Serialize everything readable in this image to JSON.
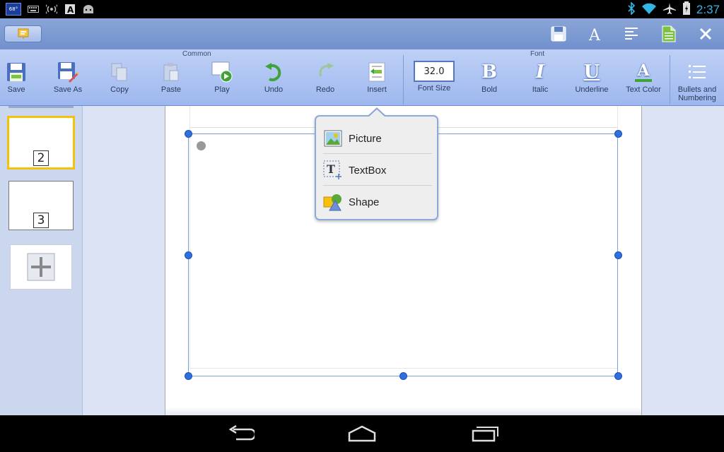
{
  "status_bar": {
    "temperature": "68°",
    "time": "2:37",
    "icons": [
      "keyboard-icon",
      "signal-icon",
      "font-app-icon",
      "android-icon",
      "bluetooth-icon",
      "wifi-icon",
      "airplane-icon",
      "battery-icon"
    ]
  },
  "title_bar": {
    "actions": [
      "save-icon",
      "font-icon",
      "align-icon",
      "document-icon",
      "close-icon"
    ]
  },
  "ribbon": {
    "common_title": "Common",
    "font_title": "Font",
    "save": "Save",
    "save_as": "Save As",
    "copy": "Copy",
    "paste": "Paste",
    "play": "Play",
    "undo": "Undo",
    "redo": "Redo",
    "insert": "Insert",
    "font_size_value": "32.0",
    "font_size": "Font Size",
    "bold": "Bold",
    "bold_glyph": "B",
    "italic": "Italic",
    "italic_glyph": "I",
    "underline": "Underline",
    "underline_glyph": "U",
    "text_color": "Text Color",
    "text_color_glyph": "A",
    "bullets": "Bullets and Numbering"
  },
  "slides": {
    "items": [
      {
        "number": "2",
        "selected": true
      },
      {
        "number": "3",
        "selected": false
      }
    ]
  },
  "insert_menu": {
    "picture": "Picture",
    "textbox": "TextBox",
    "shape": "Shape"
  },
  "colors": {
    "accent": "#33b5e5",
    "ribbon": "#bfd0f5",
    "selection": "#2e6fe0",
    "selected_slide": "#f4c20d"
  }
}
